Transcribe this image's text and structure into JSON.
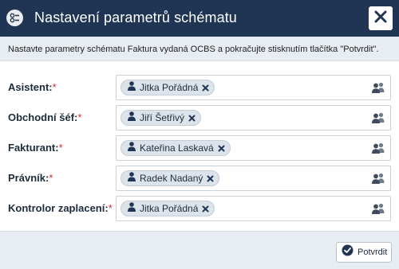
{
  "dialog": {
    "title": "Nastavení parametrů schématu",
    "info": "Nastavte parametry schématu Faktura vydaná OCBS a pokračujte stisknutím tlačítka \"Potvrdit\".",
    "colors": {
      "titlebar": "#1f3553",
      "required": "#d62828",
      "infobar": "#e8edf3"
    }
  },
  "fields": [
    {
      "label": "Asistent:",
      "required": "*",
      "user": "Jitka Pořádná"
    },
    {
      "label": "Obchodní šéf:",
      "required": "*",
      "user": "Jiří Šetřivý"
    },
    {
      "label": "Fakturant:",
      "required": "*",
      "user": "Kateřina Laskavá"
    },
    {
      "label": "Právník:",
      "required": "*",
      "user": "Radek Nadaný"
    },
    {
      "label": "Kontrolor zaplacení:",
      "required": "*",
      "user": "Jitka Pořádná"
    }
  ],
  "footer": {
    "confirm_label": "Potvrdit"
  },
  "icons": {
    "title": "settings-icon",
    "close": "close-icon",
    "user": "user-icon",
    "remove": "remove-icon",
    "group": "users-icon",
    "confirm": "check-circle-icon"
  }
}
